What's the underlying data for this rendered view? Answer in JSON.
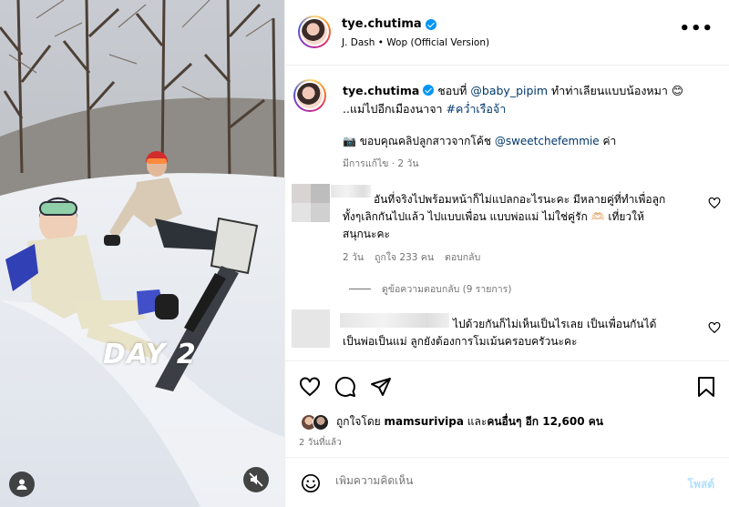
{
  "media": {
    "overlay_text": "DAY 2"
  },
  "header": {
    "username": "tye.chutima",
    "audio": "J. Dash • Wop (Official Version)",
    "more": "•••"
  },
  "caption": {
    "username": "tye.chutima",
    "part1": " ชอบที่ ",
    "mention1": "@baby_pipim",
    "part2": " ทำท่าเลียนแบบน้องหมา 😊",
    "part3": " ..แม่ไปอีกเมืองนาจา ",
    "hashtag": "#คว่ำเรือจ้า",
    "thanks_prefix": "📷 ขอบคุณคลิปลูกสาวจากโค้ช ",
    "mention2": "@sweetchefemmie",
    "thanks_suffix": " ค่า",
    "meta": "มีการแก้ไข · 2 วัน"
  },
  "comments": [
    {
      "line1": "อันที่จริงไปพร้อมหน้าก็ไม่แปลกอะไรนะคะ มีหลายคู่ที่ทำเพื่อลูก",
      "line2": "ทั้งๆเลิกกันไปแล้ว ไปแบบเพื่อน แบบพ่อแม่ ไม่ใช่คู่รัก 🫶🏻 เที่ยวให้",
      "line3": "สนุกนะคะ",
      "age": "2 วัน",
      "likes": "ถูกใจ 233 คน",
      "reply": "ตอบกลับ"
    },
    {
      "line1": "ไปด้วยกันก็ไม่เห็นเป็นไรเลย เป็นเพื่อนกันได้",
      "line2": "เป็นพ่อเป็นแม่ ลูกยังต้องการโมเม้นครอบครัวนะคะ"
    }
  ],
  "view_replies": "ดูข้อความตอบกลับ (9 รายการ)",
  "likes": {
    "prefix": "ถูกใจโดย ",
    "user": "mamsurivipa",
    "suffix": " และ",
    "others": "คนอื่นๆ อีก 12,600 คน"
  },
  "timestamp": "2 วันที่แล้ว",
  "comment_box": {
    "placeholder": "เพิ่มความคิดเห็น",
    "post_label": "โพสต์"
  }
}
